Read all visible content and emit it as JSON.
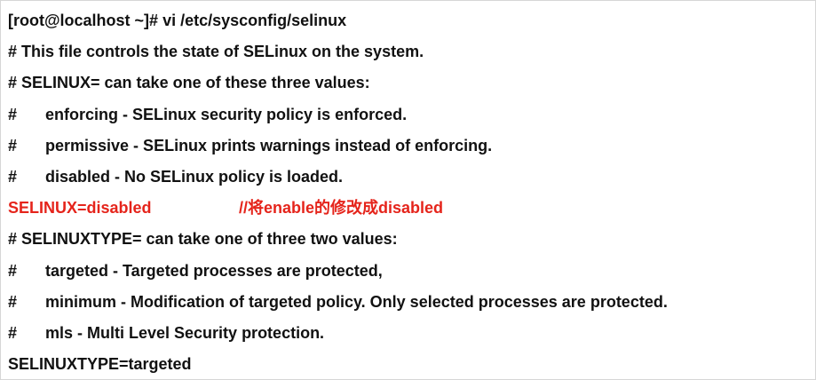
{
  "terminal": {
    "lines": [
      {
        "text": "[root@localhost ~]# vi /etc/sysconfig/selinux"
      },
      {
        "text": "# This file controls the state of SELinux on the system."
      },
      {
        "text": "# SELINUX= can take one of these three values:"
      },
      {
        "hash": "#",
        "text": "enforcing - SELinux security policy is enforced."
      },
      {
        "hash": "#",
        "text": "permissive - SELinux prints warnings instead of enforcing."
      },
      {
        "hash": "#",
        "text": "disabled - No SELinux policy is loaded."
      },
      {
        "setting": "SELINUX=disabled",
        "comment": "//将enable的修改成disabled"
      },
      {
        "text": "# SELINUXTYPE= can take one of three two values:"
      },
      {
        "hash": "#",
        "text": "targeted - Targeted processes are protected,"
      },
      {
        "hash": "#",
        "text": "minimum - Modification of targeted policy. Only selected processes are protected."
      },
      {
        "hash": "#",
        "text": "mls - Multi Level Security protection."
      },
      {
        "text": "SELINUXTYPE=targeted"
      }
    ]
  },
  "colors": {
    "text": "#111111",
    "highlight": "#e5241b",
    "background": "#ffffff",
    "border": "#d6d6d6"
  }
}
